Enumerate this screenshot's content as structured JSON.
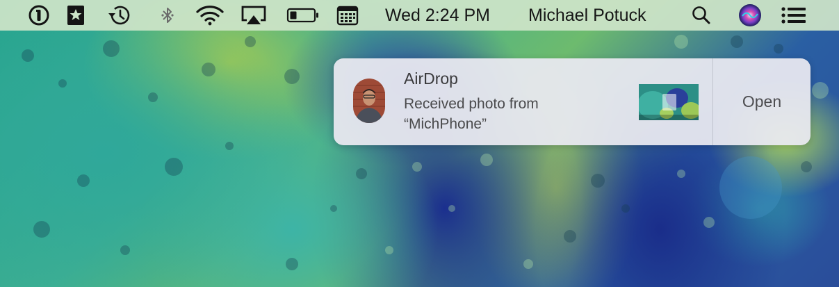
{
  "menubar": {
    "clock": "Wed 2:24 PM",
    "user": "Michael Potuck",
    "icons": [
      "1password-icon",
      "bookmark-star-icon",
      "time-machine-icon",
      "bluetooth-icon",
      "wifi-icon",
      "airplay-icon",
      "battery-icon",
      "calendar-icon",
      "spotlight-search-icon",
      "siri-icon",
      "notification-center-icon"
    ]
  },
  "notification": {
    "title": "AirDrop",
    "body_line1": "Received photo from",
    "body_line2": "“MichPhone”",
    "action": "Open"
  },
  "colors": {
    "menubar_bg": "#cde4c8",
    "notification_bg": "#e9e9f0",
    "siri_gradient": [
      "#1b1f5c",
      "#7b3fc7",
      "#d84fb0",
      "#2fd1e6"
    ]
  }
}
